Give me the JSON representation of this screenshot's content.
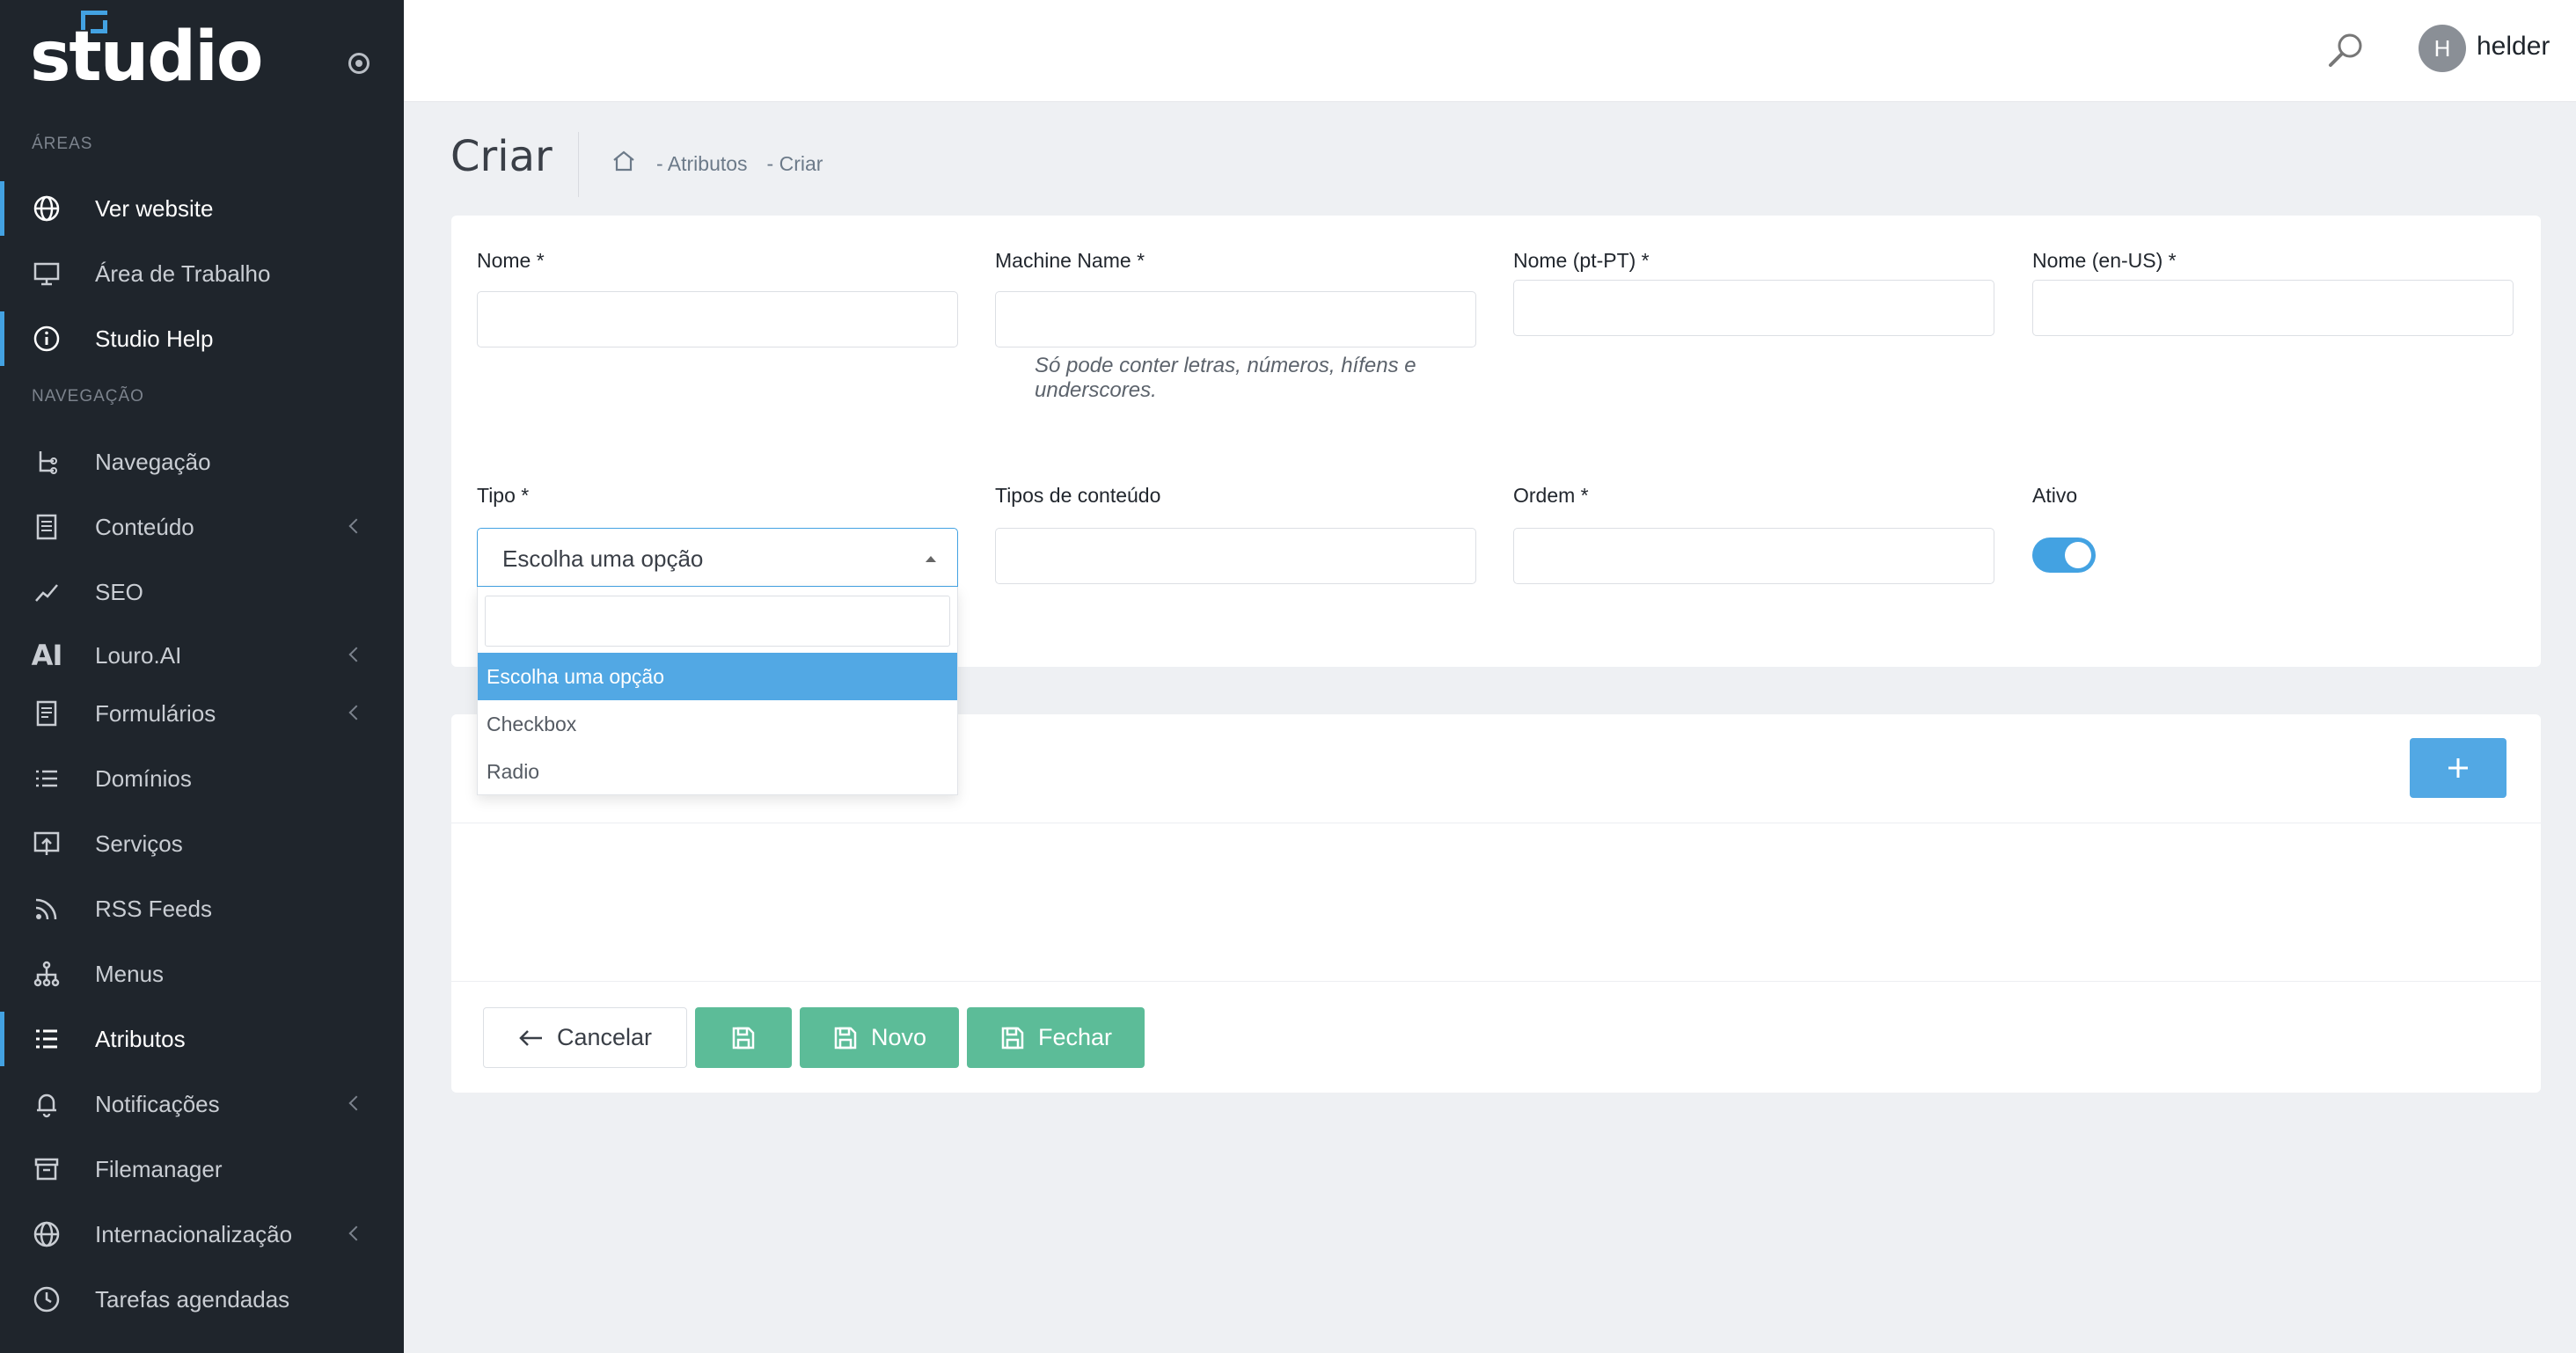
{
  "sidebar": {
    "logo_text": "studio",
    "sections": {
      "areas": "ÁREAS",
      "navigation": "NAVEGAÇÃO"
    },
    "items": [
      {
        "label": "Ver website",
        "icon": "globe-icon"
      },
      {
        "label": "Área de Trabalho",
        "icon": "monitor-icon"
      },
      {
        "label": "Studio Help",
        "icon": "info-icon"
      },
      {
        "label": "Navegação",
        "icon": "tree-icon"
      },
      {
        "label": "Conteúdo",
        "icon": "document-icon"
      },
      {
        "label": "SEO",
        "icon": "trend-icon"
      },
      {
        "label": "Louro.AI",
        "icon": "ai-icon",
        "glyph": "AI"
      },
      {
        "label": "Formulários",
        "icon": "form-icon"
      },
      {
        "label": "Domínios",
        "icon": "list-icon"
      },
      {
        "label": "Serviços",
        "icon": "upload-screen-icon"
      },
      {
        "label": "RSS Feeds",
        "icon": "rss-icon"
      },
      {
        "label": "Menus",
        "icon": "sitemap-icon"
      },
      {
        "label": "Atributos",
        "icon": "list-bullets-icon"
      },
      {
        "label": "Notificações",
        "icon": "bell-icon"
      },
      {
        "label": "Filemanager",
        "icon": "archive-icon"
      },
      {
        "label": "Internacionalização",
        "icon": "globe-icon"
      },
      {
        "label": "Tarefas agendadas",
        "icon": "clock-icon"
      }
    ]
  },
  "topbar": {
    "avatar_initial": "H",
    "username": "helder"
  },
  "page": {
    "title": "Criar",
    "breadcrumb": [
      "- Atributos",
      "- Criar"
    ]
  },
  "form": {
    "nome_label": "Nome *",
    "machine_name_label": "Machine Name *",
    "machine_name_help": "Só pode conter letras, números, hífens e underscores.",
    "nome_pt_label": "Nome (pt-PT) *",
    "nome_en_label": "Nome (en-US) *",
    "tipo_label": "Tipo *",
    "tipo_value": "Escolha uma opção",
    "tipos_conteudo_label": "Tipos de conteúdo",
    "ordem_label": "Ordem *",
    "ativo_label": "Ativo",
    "ativo_value": true
  },
  "dropdown": {
    "options": [
      "Escolha uma opção",
      "Checkbox",
      "Radio"
    ],
    "selected": "Escolha uma opção"
  },
  "actions": {
    "cancel_label": "Cancelar",
    "new_label": "Novo",
    "close_label": "Fechar"
  },
  "colors": {
    "accent": "#43a2e2",
    "success": "#5cbc98",
    "sidebar_bg": "#1f252c"
  }
}
